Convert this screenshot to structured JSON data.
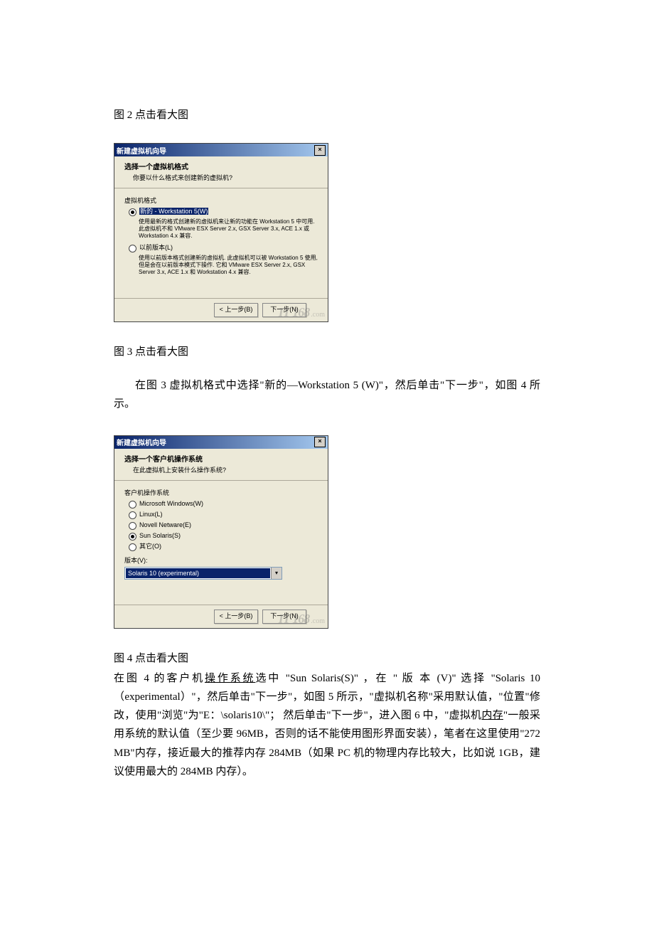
{
  "captions": {
    "fig2": "图 2  点击看大图",
    "fig3": "图 3  点击看大图",
    "fig4": "图 4  点击看大图"
  },
  "para_after_fig3": "在图 3 虚拟机格式中选择\"新的—Workstation 5 (W)\"，然后单击\"下一步\"，如图 4 所示。",
  "para_after_fig4_parts": {
    "p1a": "在图 4 的客户机",
    "p1_u1": "操作系统",
    "p1b": "选中 \"Sun Solaris(S)\" ，在 \" 版 本 (V)\" 选择 \"Solaris 10（experimental）\"，然后单击\"下一步\"，如图 5 所示，\"虚拟机名称\"采用默认值，\"位置\"修改，使用\"浏览\"为\"E：\\solaris10\\\"；  然后单击\"下一步\"，进入图 6 中，\"虚拟机",
    "p1_u2": "内存",
    "p1c": "\"一般采用系统的默认值（至少要 96MB，否则的话不能使用图形界面安装），笔者在这里使用\"272 MB\"内存，接近最大的推荐内存 284MB（如果 PC 机的物理内存比较大，比如说 1GB，建议使用最大的 284MB 内存）。"
  },
  "dialog_a": {
    "title": "新建虚拟机向导",
    "head_t1": "选择一个虚拟机格式",
    "head_t2": "你要以什么格式来创建新的虚拟机?",
    "group_label": "虚拟机格式",
    "opt1_label": "新的 - Workstation 5(W)",
    "opt1_desc": "使用最新的格式创建新的虚拟机来让新的功能在 Workstation 5 中可用. 此虚拟机不和 VMware ESX Server 2.x, GSX Server 3.x, ACE 1.x 或 Workstation 4.x 兼容.",
    "opt2_label": "以前版本(L)",
    "opt2_desc": "使用以前版本格式创建新的虚拟机. 此虚拟机可以被 Workstation 5 使用, 但是会在以前版本模式下操作. 它和 VMware ESX Server 2.x, GSX Server 3.x, ACE 1.x 和 Workstation 4.x 兼容.",
    "btn_prev": "< 上一步(B)",
    "btn_next": "下一步(N)"
  },
  "dialog_b": {
    "title": "新建虚拟机向导",
    "head_t1": "选择一个客户机操作系统",
    "head_t2": "在此虚拟机上安装什么操作系统?",
    "group_label": "客户机操作系统",
    "os1": "Microsoft Windows(W)",
    "os2": "Linux(L)",
    "os3": "Novell Netware(E)",
    "os4": "Sun Solaris(S)",
    "os5": "其它(O)",
    "version_label": "版本(V):",
    "version_value": "Solaris 10 (experimental)",
    "btn_prev": "< 上一步(B)",
    "btn_next": "下一步(N)"
  },
  "watermark": {
    "main": "IT 168",
    "suffix": ".com"
  }
}
